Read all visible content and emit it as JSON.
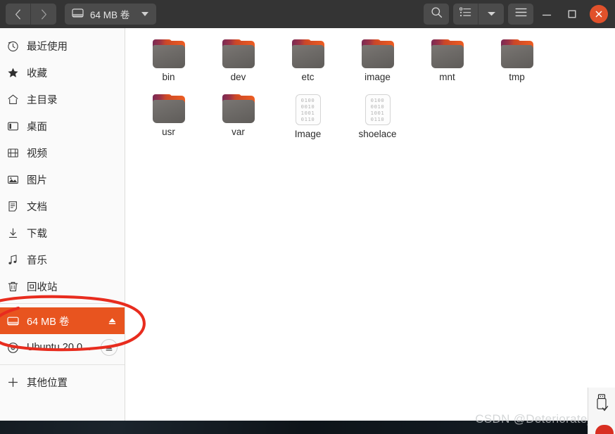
{
  "window": {
    "title": "64 MB 卷"
  },
  "header": {
    "back_label": "‹",
    "forward_label": "›",
    "path_button_label": "64 MB 卷",
    "path_icon": "drive-icon",
    "search_icon": "search-icon",
    "list_view_icon": "list-view-icon",
    "view_caret_icon": "chevron-down-icon",
    "menu_icon": "hamburger-menu-icon",
    "minimize_label": "—",
    "maximize_label": "□",
    "close_label": "✕",
    "colors": {
      "headerbar_bg": "#343434",
      "button_bg": "#4b4b4b",
      "close_bg": "#e1512b"
    }
  },
  "sidebar": {
    "items": [
      {
        "label": "最近使用",
        "icon": "clock-icon",
        "selected": false,
        "eject": "none"
      },
      {
        "label": "收藏",
        "icon": "star-icon",
        "selected": false,
        "eject": "none"
      },
      {
        "label": "主目录",
        "icon": "home-icon",
        "selected": false,
        "eject": "none"
      },
      {
        "label": "桌面",
        "icon": "desktop-icon",
        "selected": false,
        "eject": "none"
      },
      {
        "label": "视频",
        "icon": "video-icon",
        "selected": false,
        "eject": "none"
      },
      {
        "label": "图片",
        "icon": "pictures-icon",
        "selected": false,
        "eject": "none"
      },
      {
        "label": "文档",
        "icon": "documents-icon",
        "selected": false,
        "eject": "none"
      },
      {
        "label": "下载",
        "icon": "download-icon",
        "selected": false,
        "eject": "none"
      },
      {
        "label": "音乐",
        "icon": "music-icon",
        "selected": false,
        "eject": "none"
      },
      {
        "label": "回收站",
        "icon": "trash-icon",
        "selected": false,
        "eject": "none"
      },
      {
        "label": "64 MB 卷",
        "icon": "drive-icon",
        "selected": true,
        "eject": "plain"
      },
      {
        "label": "Ubuntu 20.0...",
        "icon": "disc-icon",
        "selected": false,
        "eject": "circle"
      },
      {
        "label": "其他位置",
        "icon": "plus-icon",
        "selected": false,
        "eject": "none"
      }
    ],
    "selected_bg": "#e8541f"
  },
  "files": [
    {
      "name": "bin",
      "type": "folder"
    },
    {
      "name": "dev",
      "type": "folder"
    },
    {
      "name": "etc",
      "type": "folder"
    },
    {
      "name": "image",
      "type": "folder"
    },
    {
      "name": "mnt",
      "type": "folder"
    },
    {
      "name": "tmp",
      "type": "folder"
    },
    {
      "name": "usr",
      "type": "folder"
    },
    {
      "name": "var",
      "type": "folder"
    },
    {
      "name": "Image",
      "type": "binary"
    },
    {
      "name": "shoelace",
      "type": "binary"
    }
  ],
  "binary_icon_rows": [
    "0100",
    "0010",
    "1001",
    "0110"
  ],
  "usb_panel": {
    "icon": "usb-stick-icon"
  },
  "watermark": {
    "text": "CSDN @Deteriorate_Kr"
  },
  "annotation": {
    "shape": "hand-drawn-ellipse",
    "color": "#e82c1e",
    "target": "64 MB 卷"
  }
}
